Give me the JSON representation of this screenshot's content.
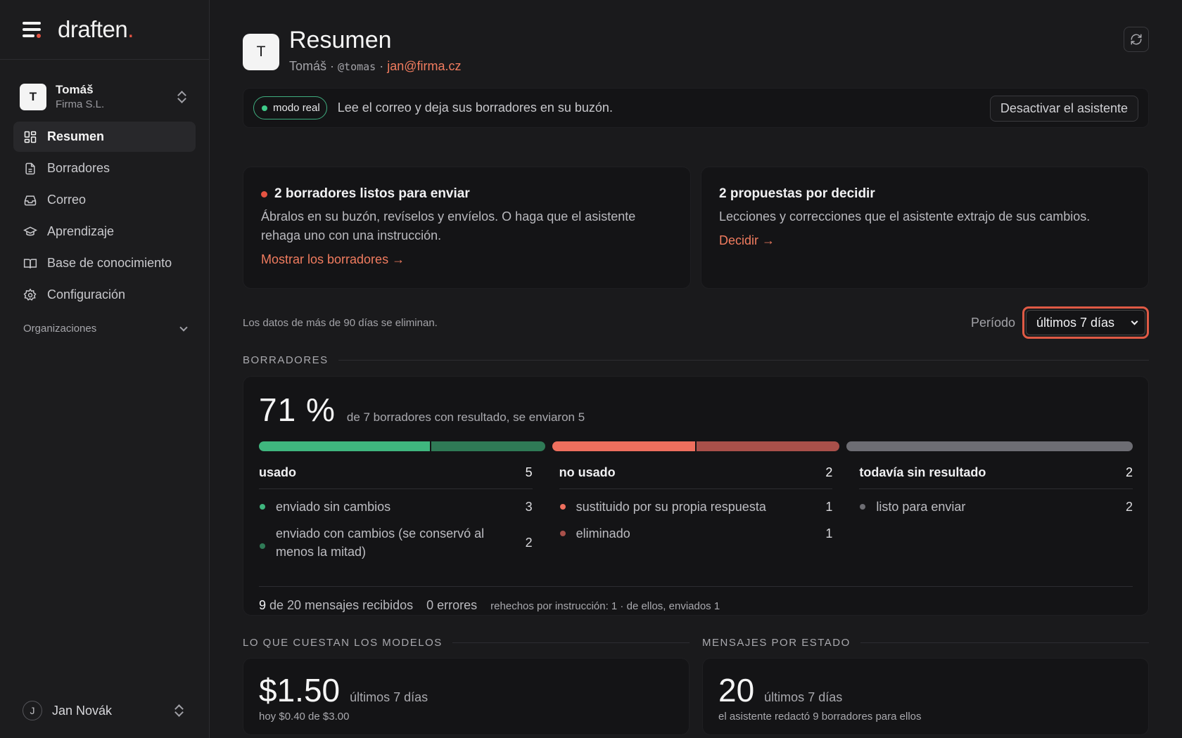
{
  "brand": {
    "name": "draften",
    "dot": "."
  },
  "account": {
    "initial": "T",
    "name": "Tomáš",
    "org": "Firma S.L."
  },
  "nav": [
    {
      "label": "Resumen",
      "icon": "dashboard-icon",
      "active": true
    },
    {
      "label": "Borradores",
      "icon": "document-icon"
    },
    {
      "label": "Correo",
      "icon": "inbox-icon"
    },
    {
      "label": "Aprendizaje",
      "icon": "graduation-cap-icon"
    },
    {
      "label": "Base de conocimiento",
      "icon": "book-icon"
    },
    {
      "label": "Configuración",
      "icon": "gear-icon"
    }
  ],
  "organizations_label": "Organizaciones",
  "user": {
    "initial": "J",
    "name": "Jan Novák"
  },
  "header": {
    "initial": "T",
    "title": "Resumen",
    "name": "Tomáš",
    "sep": " · ",
    "handle": "@tomas",
    "email": "jan@firma.cz"
  },
  "banner": {
    "mode": "modo real",
    "text": "Lee el correo y deja sus borradores en su buzón.",
    "button": "Desactivar el asistente"
  },
  "cards": [
    {
      "title": "2 borradores listos para enviar",
      "text": "Ábralos en su buzón, revíselos y envíelos. O haga que el asistente rehaga uno con una instrucción.",
      "link": "Mostrar los borradores →"
    },
    {
      "title": "2 propuestas por decidir",
      "text": "Lecciones y correcciones que el asistente extrajo de sus cambios.",
      "link": "Decidir →"
    }
  ],
  "retention_note": "Los datos de más de 90 días se eliminan.",
  "period": {
    "label": "Período",
    "selected": "últimos 7 días"
  },
  "drafts": {
    "section": "BORRADORES",
    "percent": "71 %",
    "description": "de 7 borradores con resultado, se enviaron 5",
    "groups": [
      {
        "title": "usado",
        "count": "5",
        "items": [
          {
            "label": "enviado sin cambios",
            "count": "3",
            "value": 3,
            "color": "#3fb67e"
          },
          {
            "label": "enviado con cambios (se conservó al menos la mitad)",
            "count": "2",
            "value": 2,
            "color": "#2f7a56"
          }
        ]
      },
      {
        "title": "no usado",
        "count": "2",
        "items": [
          {
            "label": "sustituido por su propia respuesta",
            "count": "1",
            "value": 1,
            "color": "#ee6f5e"
          },
          {
            "label": "eliminado",
            "count": "1",
            "value": 1,
            "color": "#a9504a"
          }
        ]
      },
      {
        "title": "todavía sin resultado",
        "count": "2",
        "items": [
          {
            "label": "listo para enviar",
            "count": "2",
            "value": 2,
            "color": "#6d6d73"
          }
        ]
      }
    ],
    "footer": {
      "received_count": "9",
      "received_text": " de 20 mensajes recibidos",
      "errors": "0 errores",
      "redone": "rehechos por instrucción: 1 · de ellos, enviados 1"
    }
  },
  "costs": {
    "section": "LO QUE CUESTAN LOS MODELOS",
    "value": "$1.50",
    "period": "últimos 7 días",
    "sub": "hoy $0.40 de $3.00"
  },
  "messages": {
    "section": "MENSAJES POR ESTADO",
    "value": "20",
    "period": "últimos 7 días",
    "sub": "el asistente redactó 9 borradores para ellos"
  }
}
